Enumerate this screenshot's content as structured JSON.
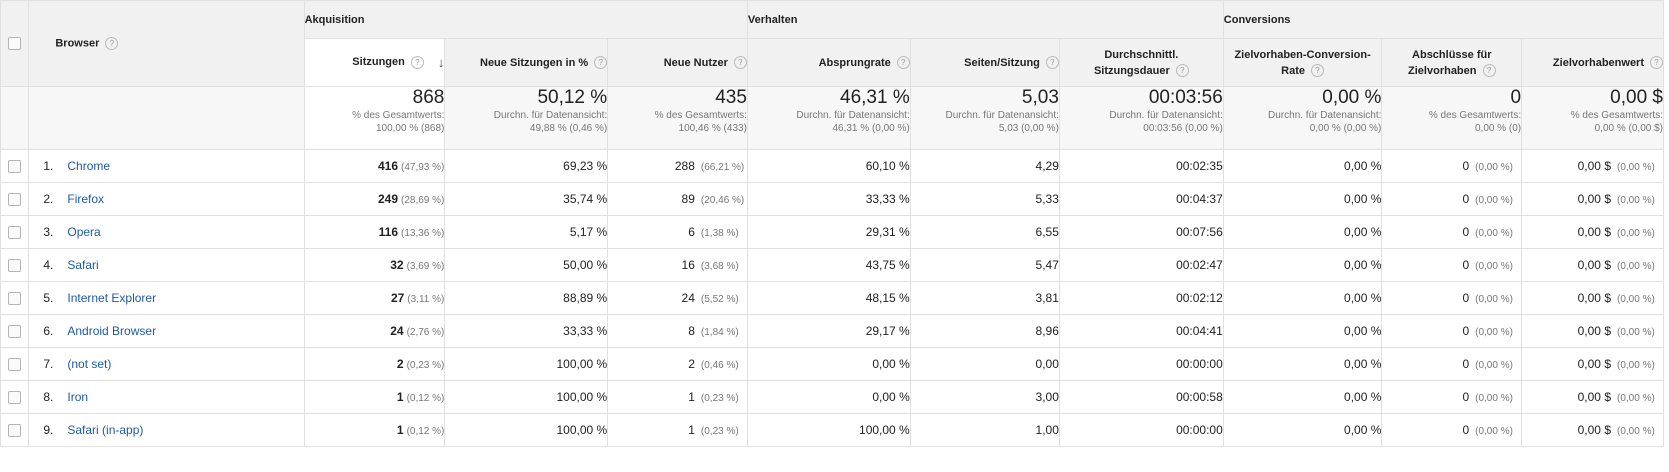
{
  "header": {
    "dimension_label": "Browser",
    "groups": [
      {
        "label": "Akquisition"
      },
      {
        "label": "Verhalten"
      },
      {
        "label": "Conversions"
      }
    ],
    "columns": [
      {
        "label": "Sitzungen"
      },
      {
        "label": "Neue Sitzungen in %"
      },
      {
        "label": "Neue Nutzer"
      },
      {
        "label": "Absprungrate"
      },
      {
        "label": "Seiten/Sitzung"
      },
      {
        "line1": "Durchschnittl.",
        "line2": "Sitzungsdauer"
      },
      {
        "line1": "Zielvorhaben-Conversion-",
        "line2": "Rate"
      },
      {
        "line1": "Abschlüsse für",
        "line2": "Zielvorhaben"
      },
      {
        "label": "Zielvorhabenwert"
      }
    ],
    "help_glyph": "?",
    "sort_glyph": "↓"
  },
  "totals": [
    {
      "value": "868",
      "line1": "% des Gesamtwerts:",
      "line2": "100,00 % (868)"
    },
    {
      "value": "50,12 %",
      "line1": "Durchn. für Datenansicht:",
      "line2": "49,88 % (0,46 %)"
    },
    {
      "value": "435",
      "line1": "% des Gesamtwerts:",
      "line2": "100,46 % (433)"
    },
    {
      "value": "46,31 %",
      "line1": "Durchn. für Datenansicht:",
      "line2": "46,31 % (0,00 %)"
    },
    {
      "value": "5,03",
      "line1": "Durchn. für Datenansicht:",
      "line2": "5,03 (0,00 %)"
    },
    {
      "value": "00:03:56",
      "line1": "Durchn. für Datenansicht:",
      "line2": "00:03:56 (0,00 %)"
    },
    {
      "value": "0,00 %",
      "line1": "Durchn. für Datenansicht:",
      "line2": "0,00 % (0,00 %)"
    },
    {
      "value": "0",
      "line1": "% des Gesamtwerts:",
      "line2": "0,00 % (0)"
    },
    {
      "value": "0,00 $",
      "line1": "% des Gesamtwerts:",
      "line2": "0,00 % (0,00 $)"
    }
  ],
  "rows": [
    {
      "index": "1.",
      "browser": "Chrome",
      "sessions": "416",
      "sessions_pct": "(47,93 %)",
      "new_sessions": "69,23 %",
      "new_users": "288",
      "new_users_pct": "(66,21 %)",
      "bounce": "60,10 %",
      "pages": "4,29",
      "duration": "00:02:35",
      "conv_rate": "0,00 %",
      "goal_compl": "0",
      "goal_compl_pct": "(0,00 %)",
      "goal_value": "0,00 $",
      "goal_value_pct": "(0,00 %)"
    },
    {
      "index": "2.",
      "browser": "Firefox",
      "sessions": "249",
      "sessions_pct": "(28,69 %)",
      "new_sessions": "35,74 %",
      "new_users": "89",
      "new_users_pct": "(20,46 %)",
      "bounce": "33,33 %",
      "pages": "5,33",
      "duration": "00:04:37",
      "conv_rate": "0,00 %",
      "goal_compl": "0",
      "goal_compl_pct": "(0,00 %)",
      "goal_value": "0,00 $",
      "goal_value_pct": "(0,00 %)"
    },
    {
      "index": "3.",
      "browser": "Opera",
      "sessions": "116",
      "sessions_pct": "(13,36 %)",
      "new_sessions": "5,17 %",
      "new_users": "6",
      "new_users_pct": "(1,38 %)",
      "bounce": "29,31 %",
      "pages": "6,55",
      "duration": "00:07:56",
      "conv_rate": "0,00 %",
      "goal_compl": "0",
      "goal_compl_pct": "(0,00 %)",
      "goal_value": "0,00 $",
      "goal_value_pct": "(0,00 %)"
    },
    {
      "index": "4.",
      "browser": "Safari",
      "sessions": "32",
      "sessions_pct": "(3,69 %)",
      "new_sessions": "50,00 %",
      "new_users": "16",
      "new_users_pct": "(3,68 %)",
      "bounce": "43,75 %",
      "pages": "5,47",
      "duration": "00:02:47",
      "conv_rate": "0,00 %",
      "goal_compl": "0",
      "goal_compl_pct": "(0,00 %)",
      "goal_value": "0,00 $",
      "goal_value_pct": "(0,00 %)"
    },
    {
      "index": "5.",
      "browser": "Internet Explorer",
      "sessions": "27",
      "sessions_pct": "(3,11 %)",
      "new_sessions": "88,89 %",
      "new_users": "24",
      "new_users_pct": "(5,52 %)",
      "bounce": "48,15 %",
      "pages": "3,81",
      "duration": "00:02:12",
      "conv_rate": "0,00 %",
      "goal_compl": "0",
      "goal_compl_pct": "(0,00 %)",
      "goal_value": "0,00 $",
      "goal_value_pct": "(0,00 %)"
    },
    {
      "index": "6.",
      "browser": "Android Browser",
      "sessions": "24",
      "sessions_pct": "(2,76 %)",
      "new_sessions": "33,33 %",
      "new_users": "8",
      "new_users_pct": "(1,84 %)",
      "bounce": "29,17 %",
      "pages": "8,96",
      "duration": "00:04:41",
      "conv_rate": "0,00 %",
      "goal_compl": "0",
      "goal_compl_pct": "(0,00 %)",
      "goal_value": "0,00 $",
      "goal_value_pct": "(0,00 %)"
    },
    {
      "index": "7.",
      "browser": "(not set)",
      "sessions": "2",
      "sessions_pct": "(0,23 %)",
      "new_sessions": "100,00 %",
      "new_users": "2",
      "new_users_pct": "(0,46 %)",
      "bounce": "0,00 %",
      "pages": "0,00",
      "duration": "00:00:00",
      "conv_rate": "0,00 %",
      "goal_compl": "0",
      "goal_compl_pct": "(0,00 %)",
      "goal_value": "0,00 $",
      "goal_value_pct": "(0,00 %)"
    },
    {
      "index": "8.",
      "browser": "Iron",
      "sessions": "1",
      "sessions_pct": "(0,12 %)",
      "new_sessions": "100,00 %",
      "new_users": "1",
      "new_users_pct": "(0,23 %)",
      "bounce": "0,00 %",
      "pages": "3,00",
      "duration": "00:00:58",
      "conv_rate": "0,00 %",
      "goal_compl": "0",
      "goal_compl_pct": "(0,00 %)",
      "goal_value": "0,00 $",
      "goal_value_pct": "(0,00 %)"
    },
    {
      "index": "9.",
      "browser": "Safari (in-app)",
      "sessions": "1",
      "sessions_pct": "(0,12 %)",
      "new_sessions": "100,00 %",
      "new_users": "1",
      "new_users_pct": "(0,23 %)",
      "bounce": "100,00 %",
      "pages": "1,00",
      "duration": "00:00:00",
      "conv_rate": "0,00 %",
      "goal_compl": "0",
      "goal_compl_pct": "(0,00 %)",
      "goal_value": "0,00 $",
      "goal_value_pct": "(0,00 %)"
    }
  ]
}
